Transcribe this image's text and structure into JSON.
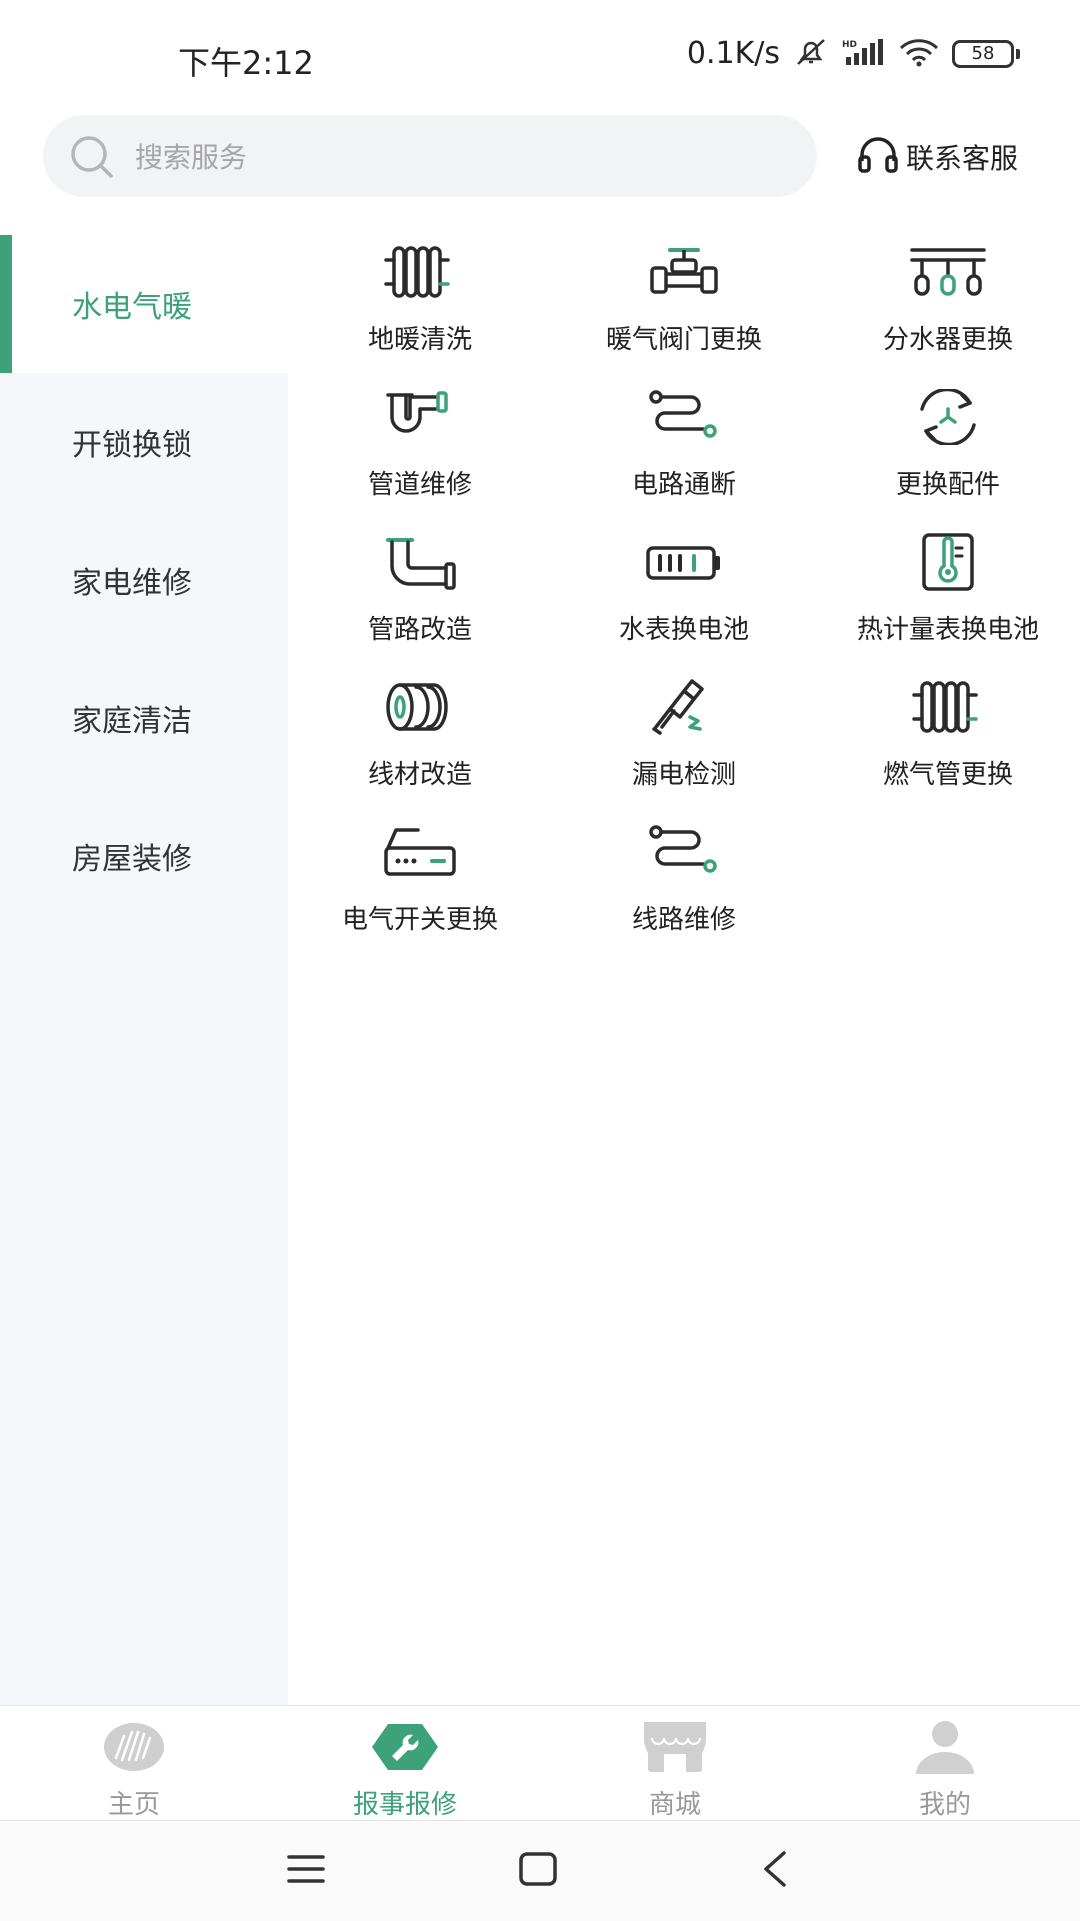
{
  "status_bar": {
    "time": "下午2:12",
    "net_speed": "0.1K/s",
    "battery": "58"
  },
  "search": {
    "placeholder": "搜索服务"
  },
  "support": {
    "label": "联系客服"
  },
  "sidebar": {
    "items": [
      {
        "label": "水电气暖",
        "active": true
      },
      {
        "label": "开锁换锁"
      },
      {
        "label": "家电维修"
      },
      {
        "label": "家庭清洁"
      },
      {
        "label": "房屋装修"
      }
    ]
  },
  "services": [
    {
      "label": "地暖清洗",
      "icon": "radiator-icon"
    },
    {
      "label": "暖气阀门更换",
      "icon": "valve-icon"
    },
    {
      "label": "分水器更换",
      "icon": "manifold-icon"
    },
    {
      "label": "管道维修",
      "icon": "drain-pipe-icon"
    },
    {
      "label": "电路通断",
      "icon": "cable-icon"
    },
    {
      "label": "更换配件",
      "icon": "replace-icon"
    },
    {
      "label": "管路改造",
      "icon": "elbow-pipe-icon"
    },
    {
      "label": "水表换电池",
      "icon": "battery-icon"
    },
    {
      "label": "热计量表换电池",
      "icon": "thermometer-icon"
    },
    {
      "label": "线材改造",
      "icon": "wire-spool-icon"
    },
    {
      "label": "漏电检测",
      "icon": "spark-plug-icon"
    },
    {
      "label": "燃气管更换",
      "icon": "radiator-icon"
    },
    {
      "label": "电气开关更换",
      "icon": "switch-box-icon"
    },
    {
      "label": "线路维修",
      "icon": "cable-icon"
    }
  ],
  "tabs": [
    {
      "label": "主页",
      "icon": "home-logo-icon"
    },
    {
      "label": "报事报修",
      "icon": "wrench-icon",
      "active": true
    },
    {
      "label": "商城",
      "icon": "store-icon"
    },
    {
      "label": "我的",
      "icon": "user-icon"
    }
  ],
  "colors": {
    "accent": "#3da17a",
    "icon_stroke": "#2b2b2b",
    "sidebar_bg": "#f5f7fb",
    "tab_inactive": "#bdbdbd"
  }
}
